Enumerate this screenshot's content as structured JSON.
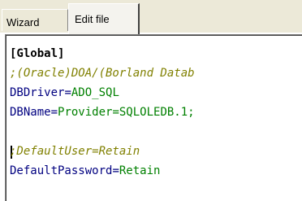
{
  "tabs": [
    {
      "label": "Wizard",
      "active": false
    },
    {
      "label": "Edit file",
      "active": true
    }
  ],
  "colors": {
    "section": "#000000",
    "comment": "#808000",
    "key": "#000080",
    "value": "#008000"
  },
  "editor": {
    "lines": [
      {
        "type": "section",
        "text": "[Global]"
      },
      {
        "type": "comment",
        "text": ";(Oracle)DOA/(Borland Datab"
      },
      {
        "type": "entry",
        "key": "DBDriver",
        "sep": "=",
        "value": "ADO_SQL"
      },
      {
        "type": "entry",
        "key": "DBName",
        "sep": "=",
        "value": "Provider=SQLOLEDB.1;"
      },
      {
        "type": "blank",
        "text": ""
      },
      {
        "type": "comment",
        "text": ";DefaultUser=Retain"
      },
      {
        "type": "entry",
        "key": "DefaultPassword",
        "sep": "=",
        "value": "Retain"
      }
    ]
  }
}
